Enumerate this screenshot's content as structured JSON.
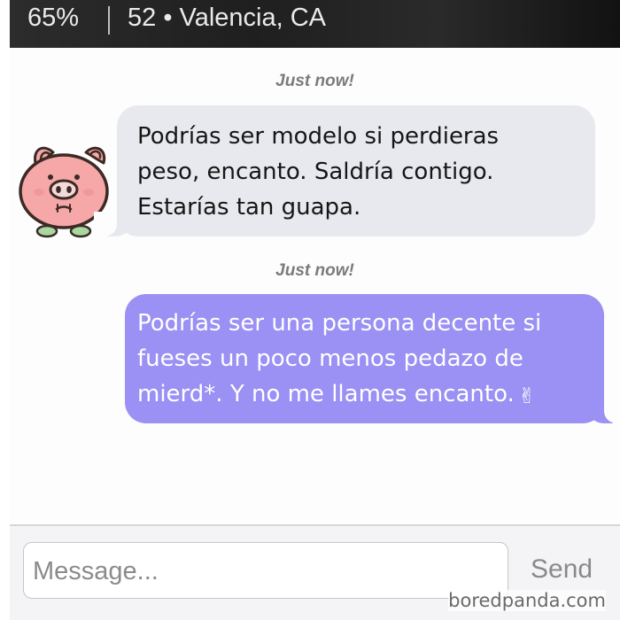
{
  "status_bar": {
    "battery": "65%",
    "location": "52 • Valencia, CA"
  },
  "conversation": {
    "messages": [
      {
        "direction": "incoming",
        "timestamp": "Just now!",
        "lines": [
          "Podrías ser modelo si perdieras",
          "peso, encanto. Saldría contigo.",
          "Estarías tan guapa."
        ]
      },
      {
        "direction": "outgoing",
        "timestamp": "Just now!",
        "lines": [
          "Podrías ser una persona decente si",
          "fueses un poco menos pedazo de",
          "mierd*. Y no me llames encanto."
        ],
        "emoji": "✌",
        "emoji_name": "victory-hand"
      }
    ]
  },
  "avatar": {
    "icon": "pig-face"
  },
  "composer": {
    "placeholder": "Message...",
    "send_label": "Send"
  },
  "watermark": "boredpanda.com",
  "colors": {
    "header_bg": "#222222",
    "incoming_bubble": "#e7e9ee",
    "outgoing_bubble": "#9b90f3",
    "pig_pink": "#f6a7a7",
    "pig_outline": "#3c2a25",
    "send_text": "#8a8a8a"
  }
}
